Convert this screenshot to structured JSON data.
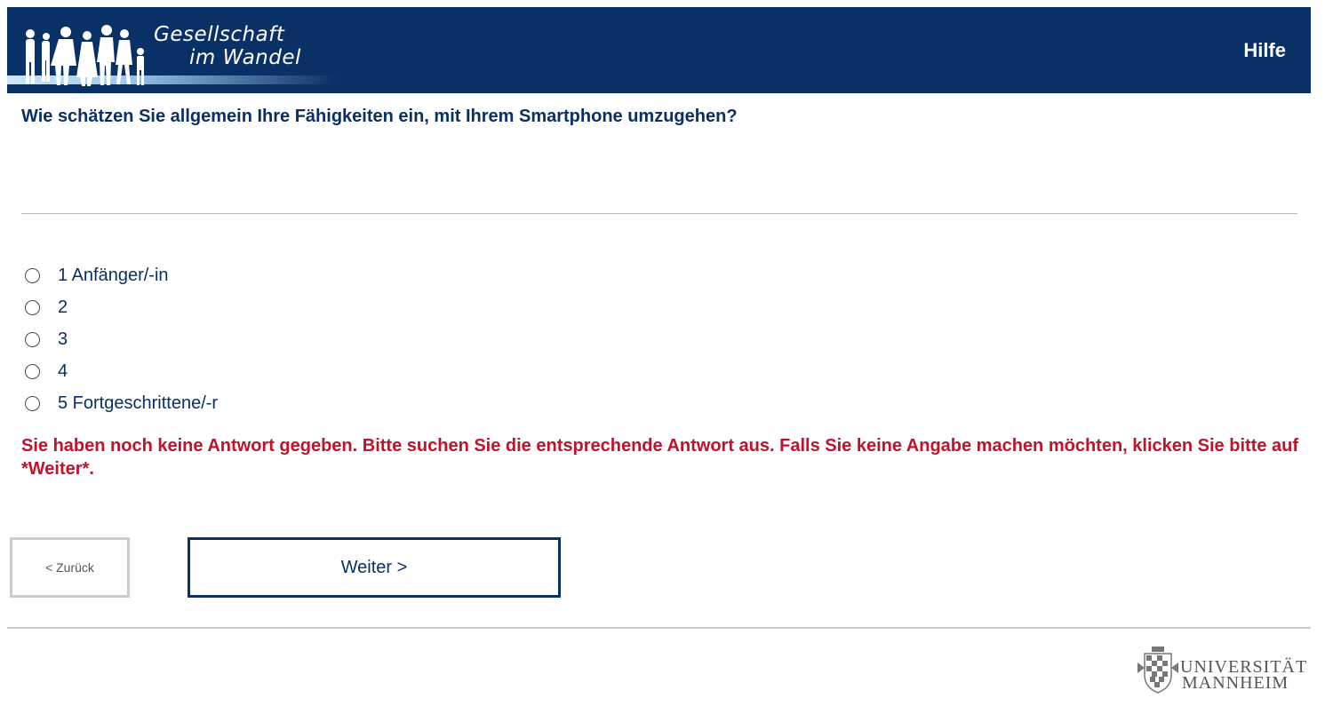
{
  "header": {
    "logo_line1": "Gesellschaft",
    "logo_line2": "im Wandel",
    "help_label": "Hilfe",
    "background_color": "#0a3166"
  },
  "question": {
    "text": "Wie schätzen Sie allgemein Ihre Fähigkeiten ein, mit Ihrem Smartphone umzugehen?"
  },
  "options": [
    {
      "label": "1 Anfänger/-in"
    },
    {
      "label": "2"
    },
    {
      "label": "3"
    },
    {
      "label": "4"
    },
    {
      "label": "5 Fortgeschrittene/-r"
    }
  ],
  "error": {
    "text": "Sie haben noch keine Antwort gegeben. Bitte suchen Sie die entsprechende Antwort aus. Falls Sie keine Angabe machen möchten, klicken Sie bitte auf *Weiter*.",
    "color": "#c0122b"
  },
  "nav": {
    "back_label": "< Zurück",
    "next_label": "Weiter >"
  },
  "footer": {
    "university_line1": "UNIVERSITÄT",
    "university_line2": "MANNHEIM"
  }
}
